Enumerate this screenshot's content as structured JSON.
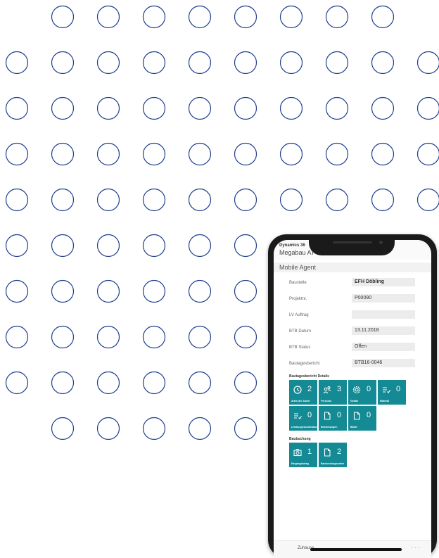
{
  "app": {
    "brand": "Dynamics 36",
    "company": "Megabau AT",
    "page_title": "Mobile Agent"
  },
  "form": [
    {
      "label": "Baustelle",
      "value": "EFH Döbling",
      "bold": true
    },
    {
      "label": "Projektnr.",
      "value": "P00090",
      "bold": false
    },
    {
      "label": "LV Auftrag",
      "value": "",
      "bold": false
    },
    {
      "label": "BTB Datum",
      "value": "13.11.2018",
      "bold": false
    },
    {
      "label": "BTB Status",
      "value": "Offen",
      "bold": false
    },
    {
      "label": "Bautagesbericht",
      "value": "BTB16-0046",
      "bold": false
    }
  ],
  "details": {
    "title": "Bautagesbericht Details",
    "tiles": [
      {
        "icon": "clock-icon",
        "count": "2",
        "label": "Arten der Arbeit"
      },
      {
        "icon": "people-icon",
        "count": "3",
        "label": "Personal"
      },
      {
        "icon": "gear-icon",
        "count": "0",
        "label": "Geräte"
      },
      {
        "icon": "list-check-icon",
        "count": "0",
        "label": "Material"
      },
      {
        "icon": "list-check-icon",
        "count": "0",
        "label": "Leistungsrückmeldung"
      },
      {
        "icon": "document-icon",
        "count": "0",
        "label": "Bemerkungen"
      },
      {
        "icon": "document-icon",
        "count": "0",
        "label": "Bilder"
      }
    ]
  },
  "booking": {
    "title": "Baubuchung",
    "tiles": [
      {
        "icon": "camera-icon",
        "count": "1",
        "label": "Eingangsbeleg"
      },
      {
        "icon": "document-icon",
        "count": "2",
        "label": "Baubuchungszeilen"
      }
    ]
  },
  "bottom": {
    "label": "Zuhause",
    "more": "· · ·"
  },
  "colors": {
    "tile": "#148a94",
    "circle_stroke": "#1f3f8f"
  }
}
